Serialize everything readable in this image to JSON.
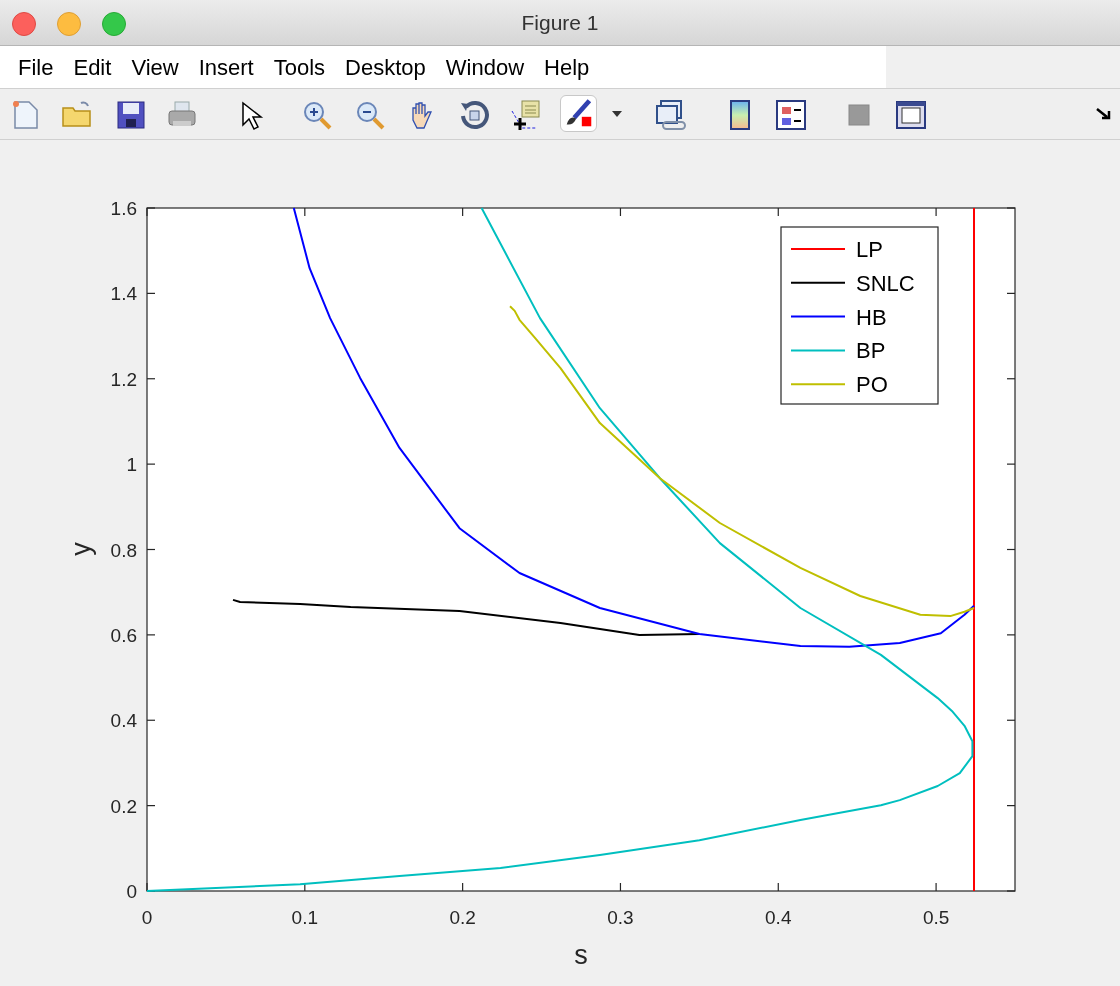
{
  "window": {
    "title": "Figure 1"
  },
  "menu": [
    "File",
    "Edit",
    "View",
    "Insert",
    "Tools",
    "Desktop",
    "Window",
    "Help"
  ],
  "plot": {
    "chart_data": {
      "type": "line",
      "xlabel": "s",
      "ylabel": "y",
      "xlim": [
        0,
        0.55
      ],
      "ylim": [
        0,
        1.6
      ],
      "legend": true,
      "xticks": [
        0,
        0.1,
        0.2,
        0.3,
        0.4,
        0.5
      ],
      "yticks": [
        0,
        0.2,
        0.4,
        0.6,
        0.8,
        1,
        1.2,
        1.4,
        1.6
      ],
      "series": [
        {
          "name": "LP",
          "color": "#ff0000",
          "x": [
            0.524,
            0.524
          ],
          "values": [
            0,
            1.6
          ]
        },
        {
          "name": "SNLC",
          "color": "#000000",
          "x": [
            0.0545,
            0.059,
            0.097,
            0.129,
            0.198,
            0.262,
            0.312,
            0.35
          ],
          "values": [
            0.682,
            0.677,
            0.672,
            0.665,
            0.656,
            0.628,
            0.6,
            0.602
          ]
        },
        {
          "name": "HB",
          "color": "#0000ff",
          "x": [
            0.093,
            0.103,
            0.116,
            0.135,
            0.16,
            0.198,
            0.236,
            0.287,
            0.35,
            0.414,
            0.445,
            0.477,
            0.503,
            0.518,
            0.524
          ],
          "values": [
            1.6,
            1.459,
            1.342,
            1.202,
            1.038,
            0.85,
            0.745,
            0.663,
            0.602,
            0.574,
            0.572,
            0.581,
            0.604,
            0.647,
            0.668
          ]
        },
        {
          "name": "BP",
          "color": "#00bfbf",
          "x": [
            0.212,
            0.249,
            0.287,
            0.325,
            0.363,
            0.414,
            0.465,
            0.501,
            0.51,
            0.518,
            0.523,
            0.523,
            0.515,
            0.501,
            0.477,
            0.465,
            0.414,
            0.35,
            0.287,
            0.224,
            0.16,
            0.097,
            0
          ],
          "values": [
            1.6,
            1.342,
            1.131,
            0.967,
            0.815,
            0.663,
            0.553,
            0.452,
            0.422,
            0.387,
            0.351,
            0.316,
            0.276,
            0.246,
            0.213,
            0.201,
            0.166,
            0.119,
            0.084,
            0.054,
            0.035,
            0.016,
            0
          ]
        },
        {
          "name": "PO",
          "color": "#bfbf00",
          "x": [
            0.23,
            0.233,
            0.236,
            0.246,
            0.262,
            0.287,
            0.325,
            0.363,
            0.414,
            0.452,
            0.49,
            0.509,
            0.518,
            0.524
          ],
          "values": [
            1.37,
            1.359,
            1.338,
            1.295,
            1.225,
            1.096,
            0.967,
            0.862,
            0.757,
            0.691,
            0.647,
            0.644,
            0.654,
            0.663
          ]
        }
      ]
    }
  }
}
